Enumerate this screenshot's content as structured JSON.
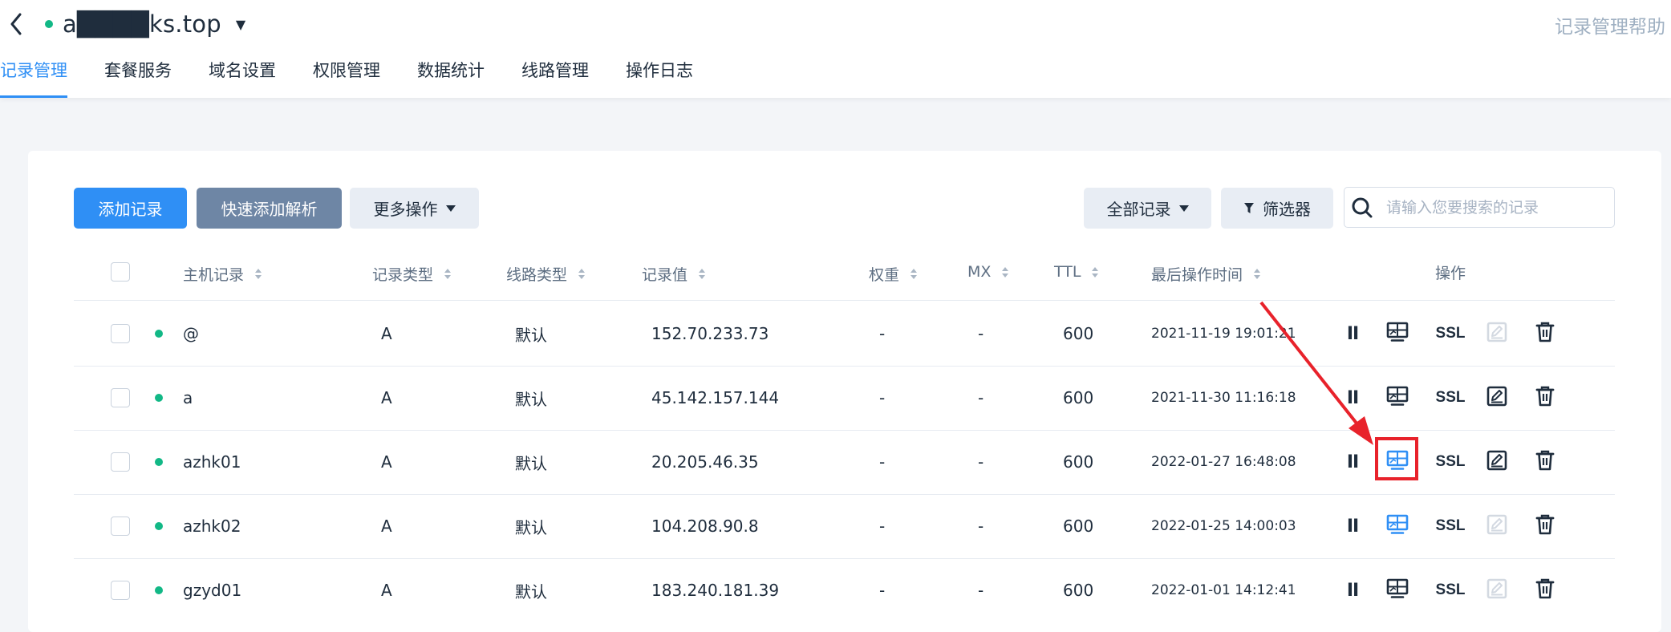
{
  "header": {
    "domain": "a████ks.top",
    "help_link": "记录管理帮助"
  },
  "tabs": [
    {
      "label": "记录管理",
      "active": true
    },
    {
      "label": "套餐服务",
      "active": false
    },
    {
      "label": "域名设置",
      "active": false
    },
    {
      "label": "权限管理",
      "active": false
    },
    {
      "label": "数据统计",
      "active": false
    },
    {
      "label": "线路管理",
      "active": false
    },
    {
      "label": "操作日志",
      "active": false
    }
  ],
  "toolbar": {
    "add_record": "添加记录",
    "quick_add": "快速添加解析",
    "more_ops": "更多操作",
    "all_records": "全部记录",
    "filter": "筛选器",
    "search_placeholder": "请输入您要搜索的记录"
  },
  "table": {
    "columns": {
      "host": "主机记录",
      "type": "记录类型",
      "line": "线路类型",
      "value": "记录值",
      "weight": "权重",
      "mx": "MX",
      "ttl": "TTL",
      "time": "最后操作时间",
      "actions": "操作"
    },
    "rows": [
      {
        "host": "@",
        "type": "A",
        "line": "默认",
        "value": "152.70.233.73",
        "weight": "-",
        "mx": "-",
        "ttl": "600",
        "time": "2021-11-19 19:01:21",
        "ssl": "SSL",
        "monitor_active": false,
        "edit_enabled": false
      },
      {
        "host": "a",
        "type": "A",
        "line": "默认",
        "value": "45.142.157.144",
        "weight": "-",
        "mx": "-",
        "ttl": "600",
        "time": "2021-11-30 11:16:18",
        "ssl": "SSL",
        "monitor_active": false,
        "edit_enabled": true
      },
      {
        "host": "azhk01",
        "type": "A",
        "line": "默认",
        "value": "20.205.46.35",
        "weight": "-",
        "mx": "-",
        "ttl": "600",
        "time": "2022-01-27 16:48:08",
        "ssl": "SSL",
        "monitor_active": true,
        "edit_enabled": true
      },
      {
        "host": "azhk02",
        "type": "A",
        "line": "默认",
        "value": "104.208.90.8",
        "weight": "-",
        "mx": "-",
        "ttl": "600",
        "time": "2022-01-25 14:00:03",
        "ssl": "SSL",
        "monitor_active": true,
        "edit_enabled": false
      },
      {
        "host": "gzyd01",
        "type": "A",
        "line": "默认",
        "value": "183.240.181.39",
        "weight": "-",
        "mx": "-",
        "ttl": "600",
        "time": "2022-01-01 14:12:41",
        "ssl": "SSL",
        "monitor_active": false,
        "edit_enabled": false
      }
    ]
  },
  "colors": {
    "primary": "#2f8ff5",
    "status_green": "#12b886",
    "annotation_red": "#e8222b"
  },
  "icons": [
    "back-arrow-icon",
    "caret-down-icon",
    "filter-icon",
    "search-icon",
    "pause-icon",
    "monitor-icon",
    "edit-icon",
    "trash-icon",
    "sort-icon"
  ]
}
